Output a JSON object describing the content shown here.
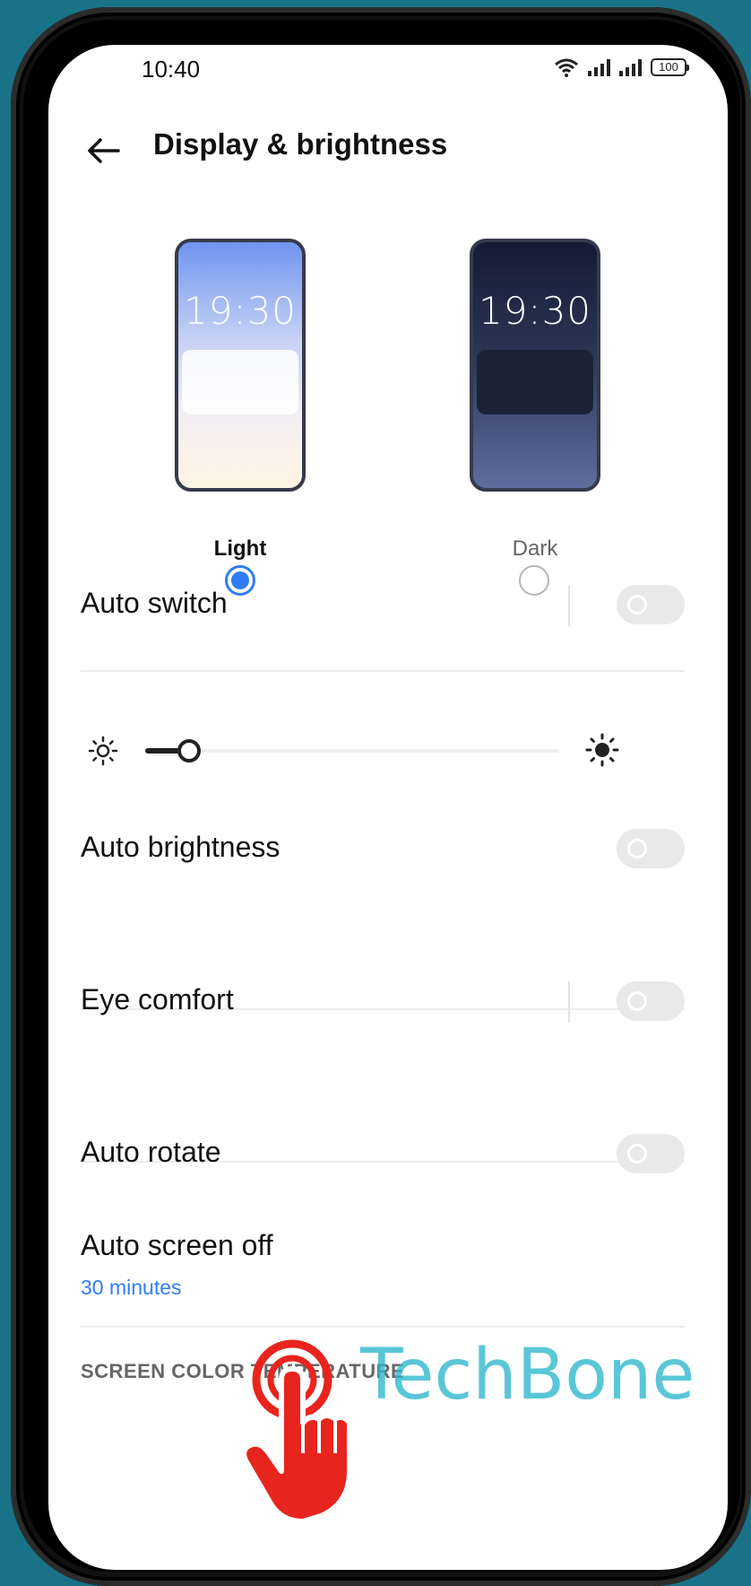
{
  "status_bar": {
    "time": "10:40",
    "battery": "100"
  },
  "header": {
    "title": "Display & brightness"
  },
  "theme": {
    "preview_clock": "19:30",
    "light_label": "Light",
    "dark_label": "Dark",
    "selected": "light"
  },
  "settings": {
    "auto_switch": "Auto switch",
    "brightness_level": 0.09,
    "auto_brightness": "Auto brightness",
    "eye_comfort": "Eye comfort",
    "auto_rotate": "Auto rotate",
    "auto_screen_off": "Auto screen off",
    "auto_screen_off_value": "30 minutes",
    "section_header": "SCREEN COLOR TEMPERATURE"
  },
  "overlay": {
    "watermark": "TechBone"
  },
  "colors": {
    "accent": "#2f7cf6",
    "watermark": "#2bb8cc",
    "hand": "#e8241f",
    "background": "#1a7286"
  }
}
